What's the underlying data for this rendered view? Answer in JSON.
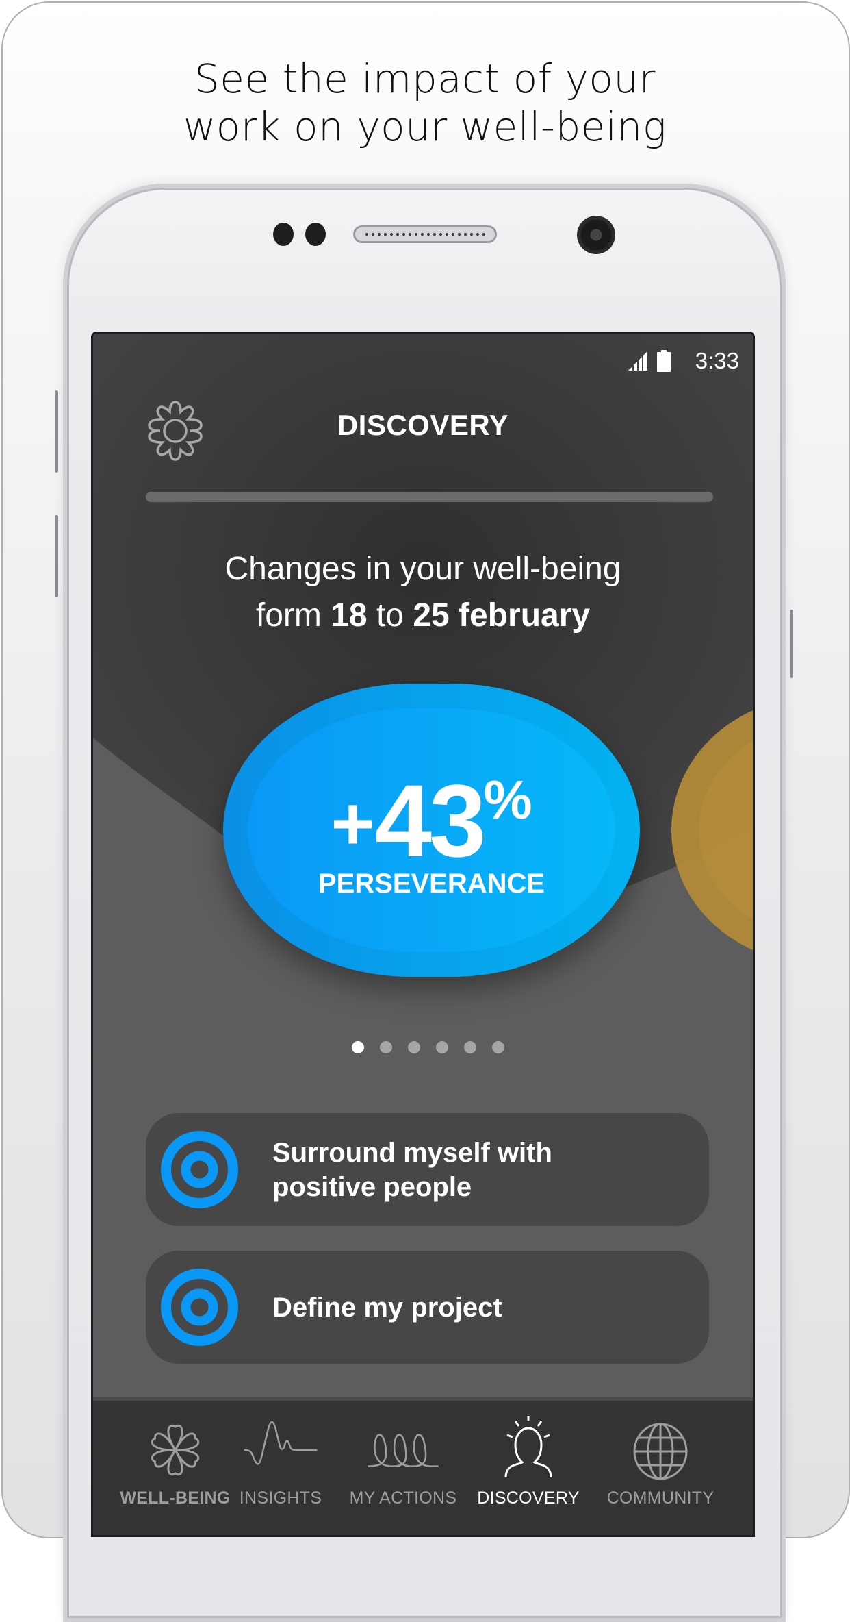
{
  "promo": {
    "line1": "See the impact of your",
    "line2": "work on your well-being"
  },
  "status_bar": {
    "time": "3:33",
    "signal_icon": "cell-signal-icon",
    "battery_icon": "battery-icon"
  },
  "header": {
    "title": "DISCOVERY",
    "settings_icon": "gear-icon"
  },
  "progress": {
    "value_percent": 100
  },
  "summary": {
    "prefix": "Changes in your well-being",
    "form_word": "form",
    "start_day": "18",
    "to_word": "to",
    "end_date": "25 february"
  },
  "carousel": {
    "current": {
      "sign": "+",
      "value": "43",
      "unit": "%",
      "label": "PERSEVERANCE",
      "color_start": "#0a90e6",
      "color_end": "#03b2f0"
    },
    "next_color": "#b48c37",
    "page_count": 6,
    "active_index": 0
  },
  "actions": [
    {
      "label": "Surround myself with\npositive people",
      "icon": "target-icon"
    },
    {
      "label": "Define my project",
      "icon": "target-icon"
    }
  ],
  "nav": {
    "items": [
      {
        "label": "WELL-BEING",
        "icon": "flower-icon",
        "active": false
      },
      {
        "label": "INSIGHTS",
        "icon": "wave-icon",
        "active": false
      },
      {
        "label": "MY ACTIONS",
        "icon": "loops-icon",
        "active": false
      },
      {
        "label": "DISCOVERY",
        "icon": "person-idea-icon",
        "active": true
      },
      {
        "label": "COMMUNITY",
        "icon": "globe-icon",
        "active": false
      }
    ]
  },
  "colors": {
    "accent_blue": "#0a98f6",
    "screen_bg": "#424242",
    "nav_bg": "#333333",
    "card_bg": "#474747"
  }
}
